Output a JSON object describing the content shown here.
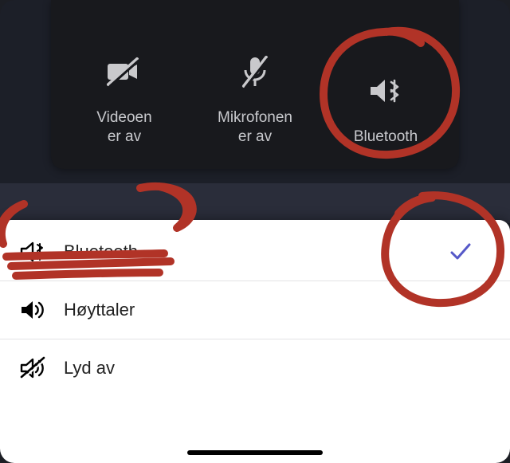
{
  "panel": {
    "video": {
      "label": "Videoen\ner av",
      "icon": "video-off-icon"
    },
    "mic": {
      "label": "Mikrofonen\ner av",
      "icon": "mic-off-icon"
    },
    "audio": {
      "label": "Bluetooth",
      "icon": "speaker-bluetooth-icon"
    }
  },
  "sheet": {
    "options": [
      {
        "id": "bluetooth",
        "label": "Bluetooth",
        "icon": "speaker-bluetooth-outline-icon",
        "selected": true
      },
      {
        "id": "speaker",
        "label": "Høyttaler",
        "icon": "speaker-icon",
        "selected": false
      },
      {
        "id": "mute",
        "label": "Lyd av",
        "icon": "speaker-mute-icon",
        "selected": false
      }
    ]
  },
  "colors": {
    "accent": "#5558c8",
    "panel_bg": "#18191d",
    "sheet_bg": "#ffffff",
    "scribble": "#b13327"
  }
}
